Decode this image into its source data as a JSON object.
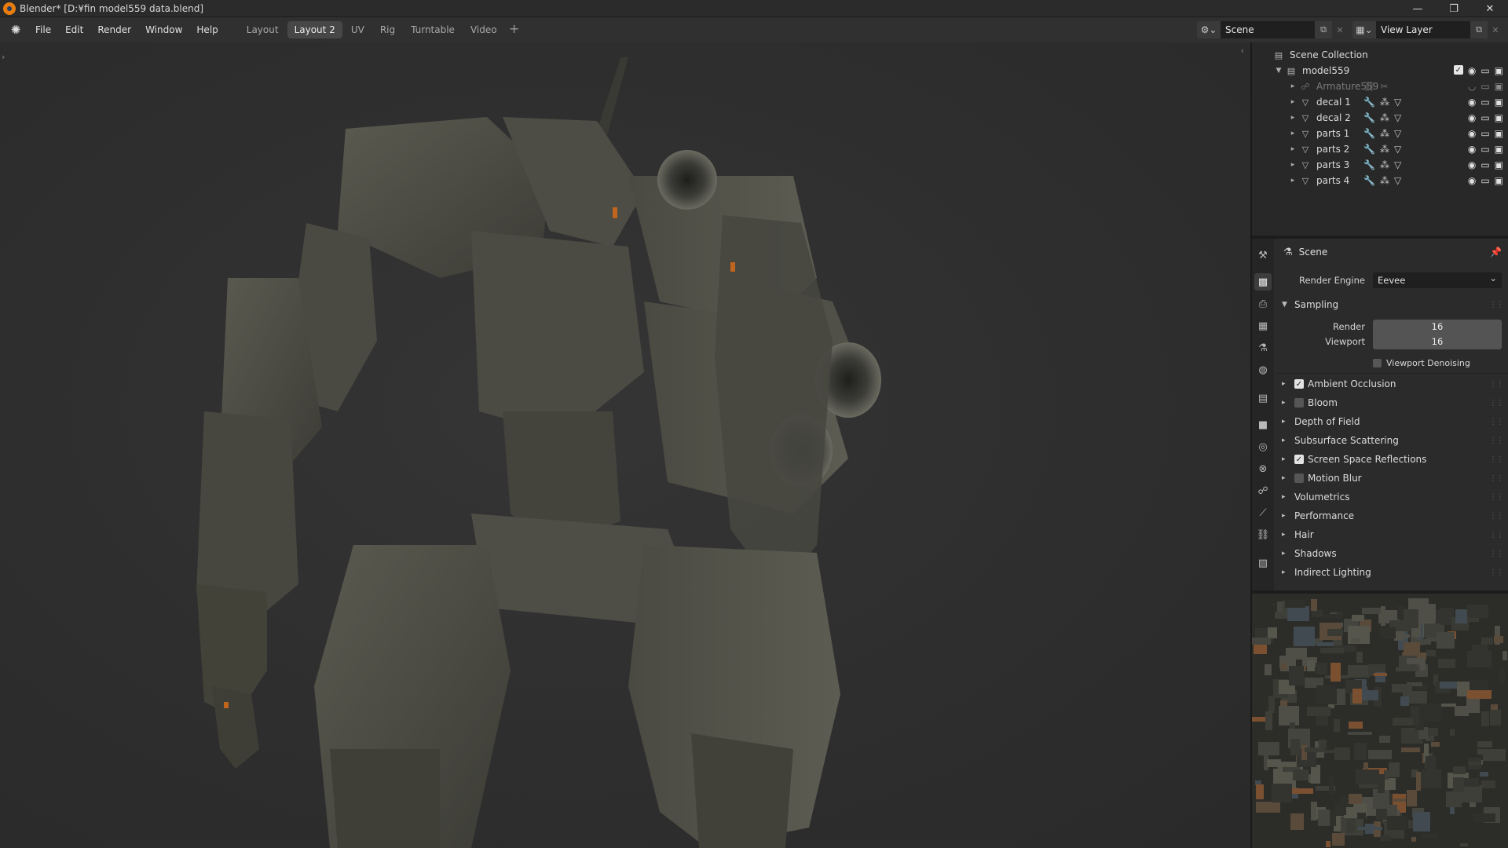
{
  "window": {
    "title": "Blender* [D:¥fin model559 data.blend]",
    "controls": [
      "—",
      "❐",
      "✕"
    ]
  },
  "menubar": {
    "items": [
      "File",
      "Edit",
      "Render",
      "Window",
      "Help"
    ],
    "tabs": [
      "Layout",
      "Layout 2",
      "UV",
      "Rig",
      "Turntable",
      "Video"
    ],
    "active_tab": "Layout 2",
    "add_tab": "+",
    "scene": "Scene",
    "view_layer": "View Layer"
  },
  "outliner": {
    "root": "Scene Collection",
    "collection": "model559",
    "items": [
      {
        "name": "Armature559",
        "type": "armature",
        "dim": true
      },
      {
        "name": "decal 1",
        "type": "mesh"
      },
      {
        "name": "decal 2",
        "type": "mesh"
      },
      {
        "name": "parts 1",
        "type": "mesh"
      },
      {
        "name": "parts 2",
        "type": "mesh"
      },
      {
        "name": "parts 3",
        "type": "mesh"
      },
      {
        "name": "parts 4",
        "type": "mesh"
      }
    ]
  },
  "properties": {
    "header": "Scene",
    "render_engine_label": "Render Engine",
    "render_engine": "Eevee",
    "sampling": {
      "title": "Sampling",
      "render_label": "Render",
      "render_value": "16",
      "viewport_label": "Viewport",
      "viewport_value": "16",
      "denoise_label": "Viewport Denoising"
    },
    "panels": [
      {
        "label": "Ambient Occlusion",
        "checkbox": true,
        "checked": true
      },
      {
        "label": "Bloom",
        "checkbox": true,
        "checked": false
      },
      {
        "label": "Depth of Field",
        "checkbox": false
      },
      {
        "label": "Subsurface Scattering",
        "checkbox": false
      },
      {
        "label": "Screen Space Reflections",
        "checkbox": true,
        "checked": true
      },
      {
        "label": "Motion Blur",
        "checkbox": true,
        "checked": false
      },
      {
        "label": "Volumetrics",
        "checkbox": false
      },
      {
        "label": "Performance",
        "checkbox": false
      },
      {
        "label": "Hair",
        "checkbox": false
      },
      {
        "label": "Shadows",
        "checkbox": false
      },
      {
        "label": "Indirect Lighting",
        "checkbox": false
      }
    ]
  },
  "colors": {
    "accent": "#e87d0d",
    "panel_bg": "#2b2b2b",
    "field_bg": "#545454"
  }
}
